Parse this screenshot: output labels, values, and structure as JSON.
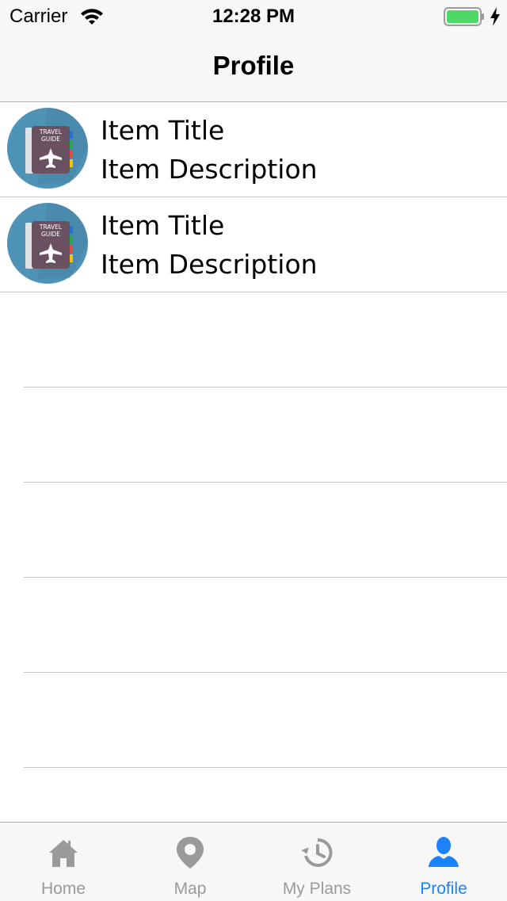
{
  "status_bar": {
    "carrier": "Carrier",
    "time": "12:28 PM",
    "icons": [
      "wifi-icon",
      "battery-icon",
      "charging-bolt-icon"
    ],
    "battery_color": "#4cd964"
  },
  "nav": {
    "title": "Profile"
  },
  "list": {
    "items": [
      {
        "title": "Item Title",
        "description": "Item Description",
        "thumbnail_text": [
          "TRAVEL",
          "GUIDE"
        ],
        "thumbnail_icon": "travel-guide-book-icon"
      },
      {
        "title": "Item Title",
        "description": "Item Description",
        "thumbnail_text": [
          "TRAVEL",
          "GUIDE"
        ],
        "thumbnail_icon": "travel-guide-book-icon"
      }
    ]
  },
  "tab_bar": {
    "active_color": "#1a82fb",
    "inactive_color": "#9a9a9a",
    "tabs": [
      {
        "label": "Home",
        "icon": "home-icon",
        "active": false
      },
      {
        "label": "Map",
        "icon": "map-pin-icon",
        "active": false
      },
      {
        "label": "My Plans",
        "icon": "history-icon",
        "active": false
      },
      {
        "label": "Profile",
        "icon": "person-icon",
        "active": true
      }
    ]
  }
}
